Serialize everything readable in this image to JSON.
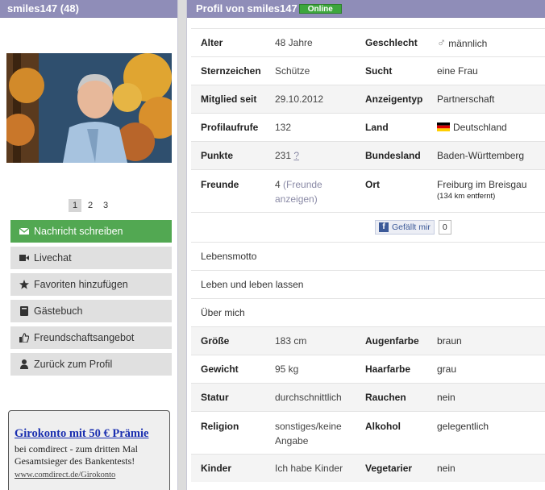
{
  "left": {
    "header": "smiles147 (48)",
    "pager": [
      "1",
      "2",
      "3"
    ],
    "actions": [
      {
        "icon": "envelope-icon",
        "label": "Nachricht schreiben"
      },
      {
        "icon": "video-camera-icon",
        "label": "Livechat"
      },
      {
        "icon": "star-icon",
        "label": "Favoriten hinzufügen"
      },
      {
        "icon": "book-icon",
        "label": "Gästebuch"
      },
      {
        "icon": "thumbs-up-icon",
        "label": "Freundschaftsangebot"
      },
      {
        "icon": "user-icon",
        "label": "Zurück zum Profil"
      }
    ],
    "ad": {
      "title": "Girokonto mit 50 € Prämie",
      "text": "bei comdirect - zum dritten Mal Gesamtsieger des Bankentests!",
      "url": "www.comdirect.de/Girokonto"
    }
  },
  "right": {
    "header": "Profil von smiles147",
    "status": "Online",
    "rows": [
      {
        "k1": "Alter",
        "v1": "48 Jahre",
        "k2": "Geschlecht",
        "v2": "männlich"
      },
      {
        "k1": "Sternzeichen",
        "v1": "Schütze",
        "k2": "Sucht",
        "v2": "eine Frau"
      },
      {
        "k1": "Mitglied seit",
        "v1": "29.10.2012",
        "k2": "Anzeigentyp",
        "v2": "Partnerschaft"
      },
      {
        "k1": "Profilaufrufe",
        "v1": "132",
        "k2": "Land",
        "v2": "Deutschland"
      },
      {
        "k1": "Punkte",
        "v1": "231",
        "v1_link": "?",
        "k2": "Bundesland",
        "v2": "Baden-Württemberg"
      },
      {
        "k1": "Freunde",
        "v1": "4",
        "v1_link": "(Freunde anzeigen)",
        "k2": "Ort",
        "v2": "Freiburg im Breisgau",
        "v2_sub": "(134 km entfernt)"
      }
    ],
    "facebook": {
      "label": "Gefällt mir",
      "count": "0"
    },
    "lebensmotto_label": "Lebensmotto",
    "lebensmotto": "Leben und leben lassen",
    "ueber_mich_label": "Über mich",
    "details": [
      {
        "k1": "Größe",
        "v1": "183 cm",
        "k2": "Augenfarbe",
        "v2": "braun"
      },
      {
        "k1": "Gewicht",
        "v1": "95 kg",
        "k2": "Haarfarbe",
        "v2": "grau"
      },
      {
        "k1": "Statur",
        "v1": "durchschnittlich",
        "k2": "Rauchen",
        "v2": "nein"
      },
      {
        "k1": "Religion",
        "v1": "sonstiges/keine Angabe",
        "k2": "Alkohol",
        "v2": "gelegentlich"
      },
      {
        "k1": "Kinder",
        "v1": "Ich habe Kinder",
        "k2": "Vegetarier",
        "v2": "nein"
      }
    ]
  }
}
